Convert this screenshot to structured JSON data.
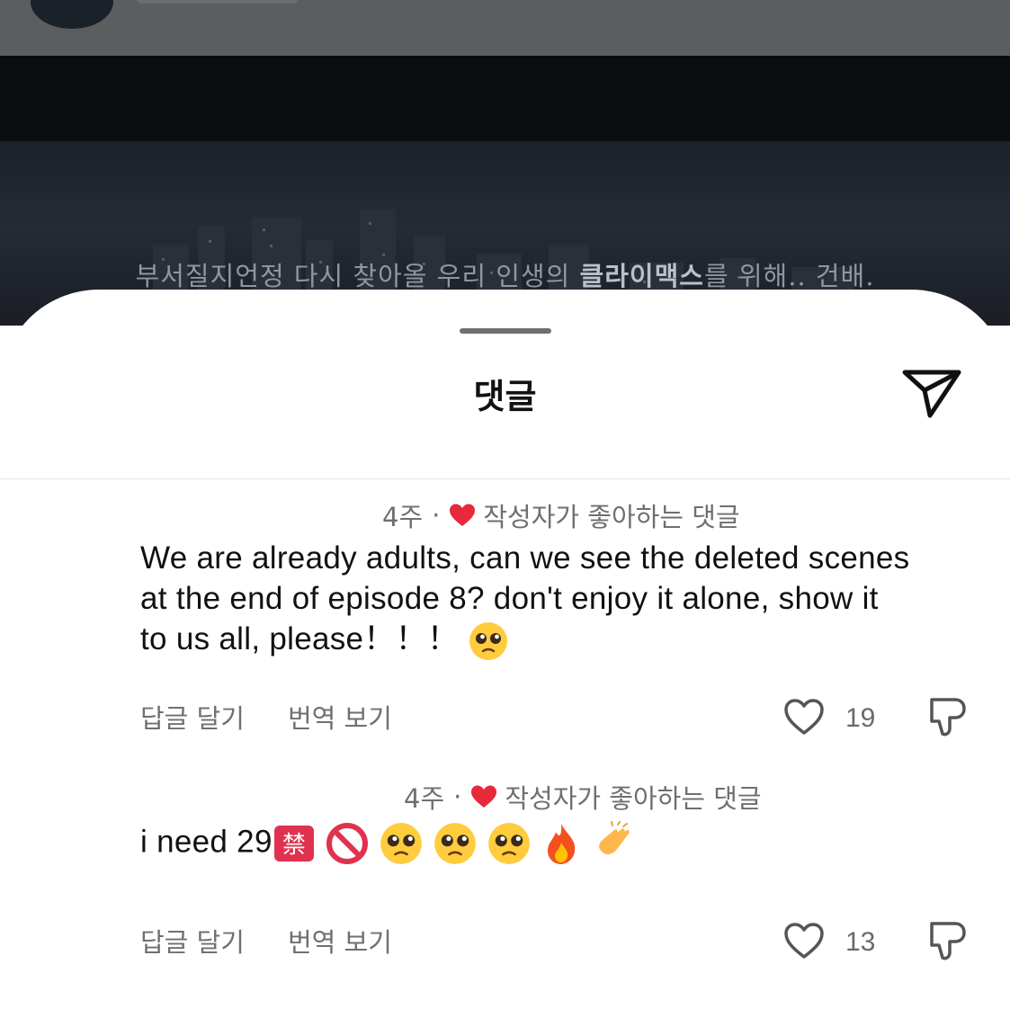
{
  "video": {
    "subtitle_before": "부서질지언정 다시 찾아올 우리 인생의 ",
    "subtitle_highlight": "클라이맥스",
    "subtitle_after": "를 위해.. 건배."
  },
  "sheet": {
    "title": "댓글"
  },
  "comments": [
    {
      "age": "4주",
      "separator": "·",
      "creator_liked": "작성자가 좋아하는 댓글",
      "text": "We are already adults, can we see the deleted scenes at the end of episode 8? don't enjoy it alone, show it to us all, please！！！",
      "reply_label": "답글 달기",
      "translate_label": "번역 보기",
      "like_count": "19"
    },
    {
      "age": "4주",
      "separator": "·",
      "creator_liked": "작성자가 좋아하는 댓글",
      "text": "i need 29",
      "reply_label": "답글 달기",
      "translate_label": "번역 보기",
      "like_count": "13"
    }
  ],
  "emoji_icons": [
    "pleading-face-emoji",
    "forbidden-kanji-emoji",
    "no-entry-sign-emoji",
    "fire-emoji",
    "clapping-hands-emoji"
  ],
  "colors": {
    "liked_heart": "#e8283b",
    "top_bar": "#5b5d5f",
    "muted_text": "#6f6f6f"
  }
}
